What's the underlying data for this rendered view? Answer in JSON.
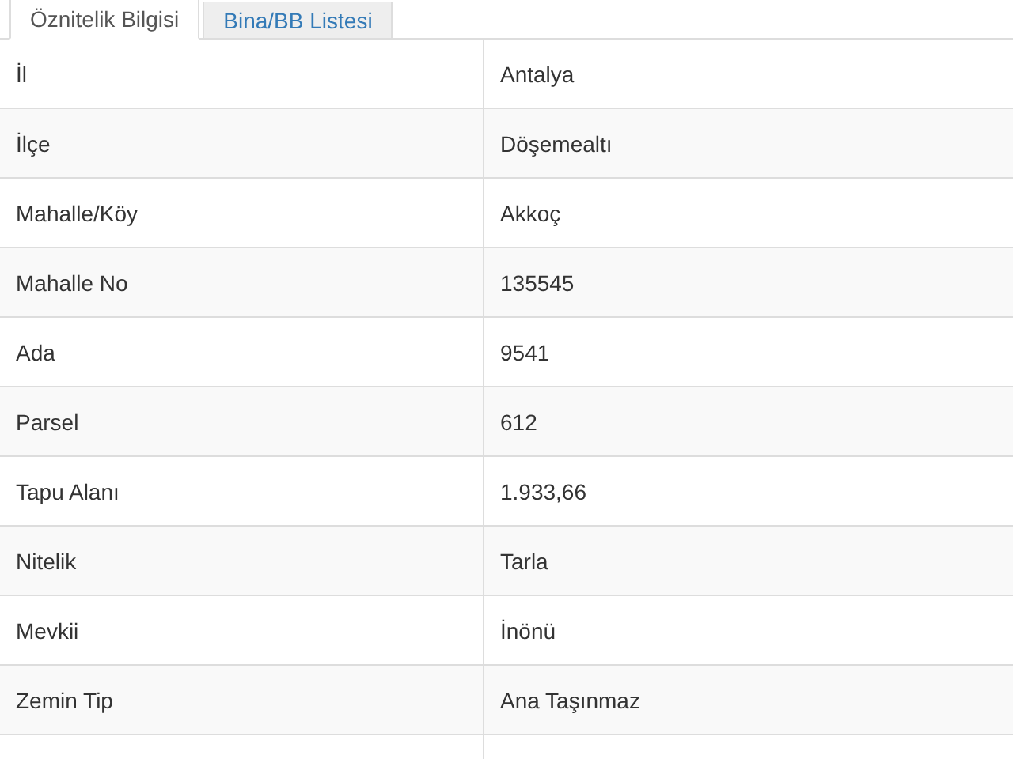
{
  "tabs": [
    {
      "label": "Öznitelik Bilgisi",
      "selected": true
    },
    {
      "label": "Bina/BB Listesi",
      "selected": false
    }
  ],
  "table": {
    "rows": [
      {
        "label": "İl",
        "value": "Antalya"
      },
      {
        "label": "İlçe",
        "value": "Döşemealtı"
      },
      {
        "label": "Mahalle/Köy",
        "value": "Akkoç"
      },
      {
        "label": "Mahalle No",
        "value": "135545"
      },
      {
        "label": "Ada",
        "value": "9541"
      },
      {
        "label": "Parsel",
        "value": "612"
      },
      {
        "label": "Tapu Alanı",
        "value": "1.933,66"
      },
      {
        "label": "Nitelik",
        "value": "Tarla"
      },
      {
        "label": "Mevkii",
        "value": "İnönü"
      },
      {
        "label": "Zemin Tip",
        "value": "Ana Taşınmaz"
      }
    ]
  }
}
